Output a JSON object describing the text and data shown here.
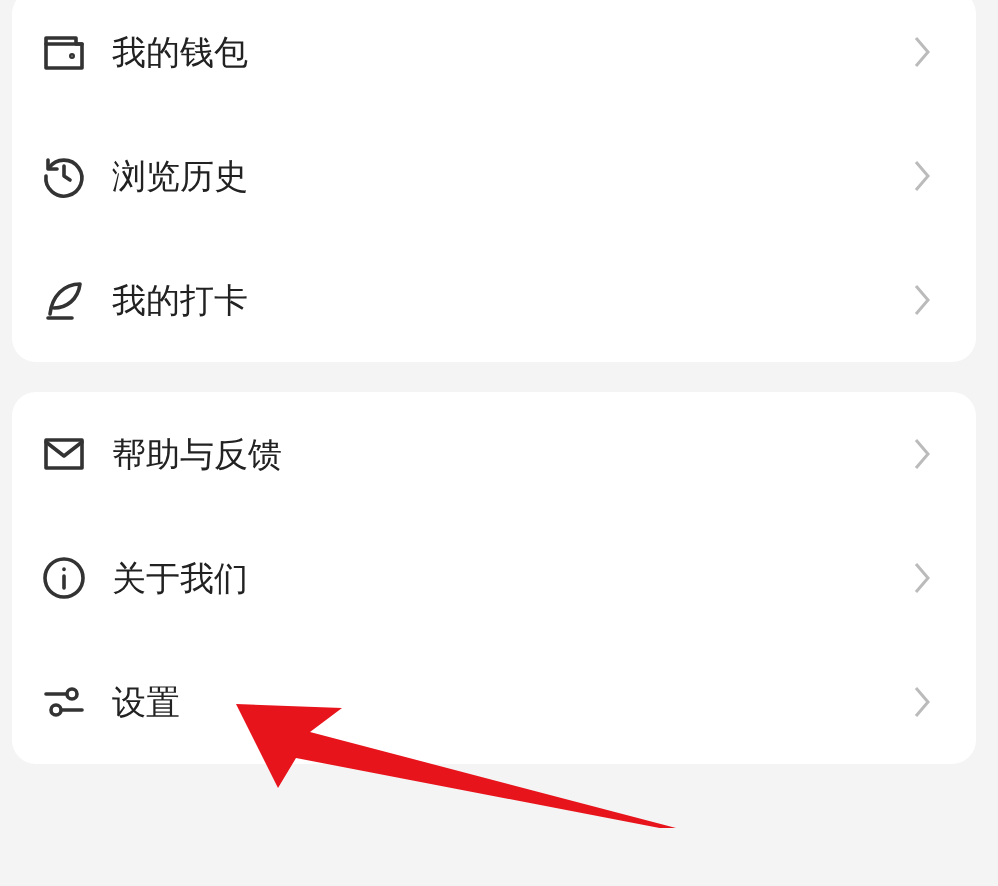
{
  "groups": [
    {
      "items": [
        {
          "kind": "wallet",
          "label": "我的钱包"
        },
        {
          "kind": "history",
          "label": "浏览历史"
        },
        {
          "kind": "feather",
          "label": "我的打卡"
        }
      ]
    },
    {
      "items": [
        {
          "kind": "mail",
          "label": "帮助与反馈"
        },
        {
          "kind": "info",
          "label": "关于我们"
        },
        {
          "kind": "sliders",
          "label": "设置"
        }
      ]
    }
  ]
}
